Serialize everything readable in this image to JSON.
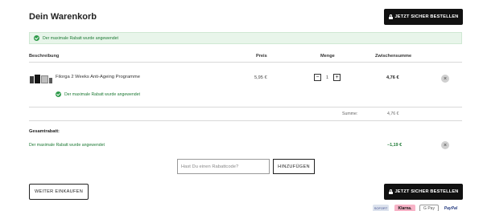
{
  "page_title": "Dein Warenkorb",
  "checkout_label": "JETZT SICHER BESTELLEN",
  "discount_notice": "Der maximale Rabatt wurde angewendet",
  "table": {
    "headers": {
      "description": "Beschreibung",
      "price": "Preis",
      "quantity": "Menge",
      "subtotal": "Zwischensumme"
    }
  },
  "item": {
    "name": "Filorga 2 Weeks Anti-Ageing Programme",
    "price": "5,95 €",
    "quantity": "1",
    "decrease": "−",
    "increase": "+",
    "discount_text": "Der maximale Rabatt wurde angewendet",
    "subtotal": "4,76 €",
    "remove": "×"
  },
  "summary": {
    "label": "Summe:",
    "value": "4,76 €"
  },
  "total_discount": {
    "label": "Gesamtrabatt:",
    "text": "Der maximale Rabatt wurde angewendet",
    "value": "−1,19 €",
    "remove": "×"
  },
  "coupon": {
    "placeholder": "Hast Du einen Rabattcode?",
    "button": "HINZUFÜGEN"
  },
  "continue_label": "WEITER EINKAUFEN",
  "payment_methods": [
    "SOFORT",
    "Klarna.",
    "G Pay",
    "PayPal"
  ],
  "colors": {
    "notice_bg": "#e8f5ea",
    "success_green": "#1e7a35",
    "button_dark": "#111111"
  }
}
